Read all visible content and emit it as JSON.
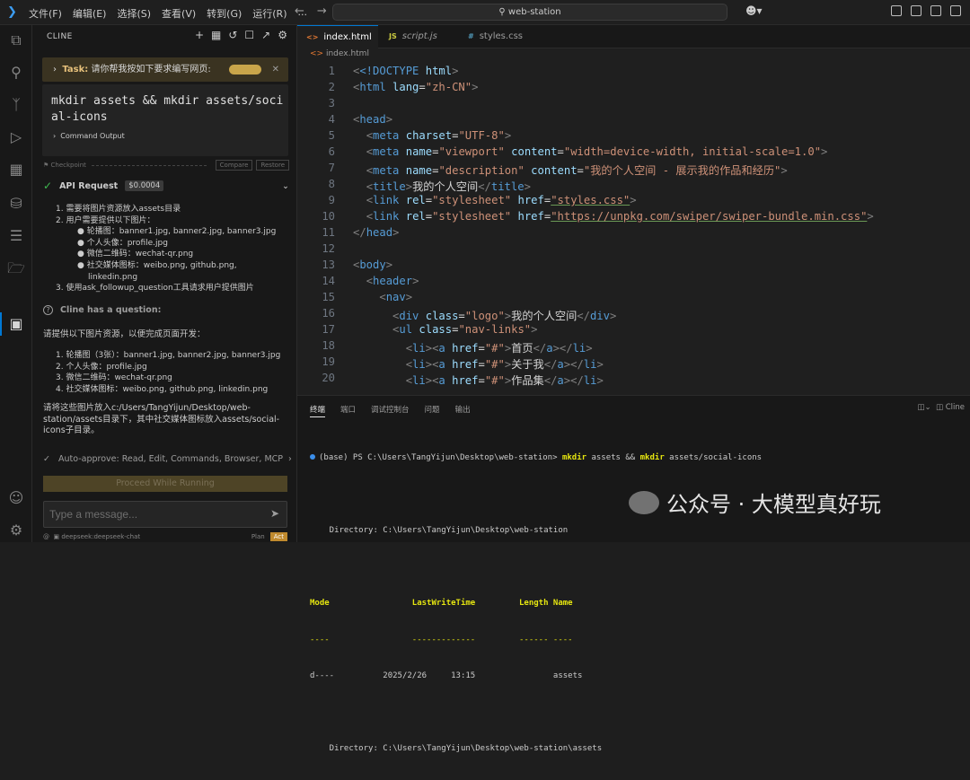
{
  "menu": [
    "文件(F)",
    "编辑(E)",
    "选择(S)",
    "查看(V)",
    "转到(G)",
    "运行(R)",
    "..."
  ],
  "search": {
    "text": "web-station"
  },
  "sidebar": {
    "title": "CLINE",
    "task_label": "Task:",
    "task_text": "请你帮我按如下要求编写网页:",
    "command": "mkdir assets && mkdir assets/social-icons",
    "command_output": "Command Output",
    "checkpoint": "Checkpoint",
    "compare": "Compare",
    "restore": "Restore",
    "api_label": "API Request",
    "api_cost": "$0.0004",
    "list1": [
      "1. 需要将图片资源放入assets目录",
      "2. 用户需要提供以下图片：",
      "轮播图：banner1.jpg, banner2.jpg, banner3.jpg",
      "个人头像：profile.jpg",
      "微信二维码：wechat-qr.png",
      "社交媒体图标：weibo.png, github.png,",
      "linkedin.png",
      "3. 使用ask_followup_question工具请求用户提供图片"
    ],
    "question_label": "Cline has a question:",
    "question_intro": "请提供以下图片资源，以便完成页面开发：",
    "list2": [
      "1. 轮播图（3张）：banner1.jpg, banner2.jpg, banner3.jpg",
      "2. 个人头像：profile.jpg",
      "3. 微信二维码：wechat-qr.png",
      "4. 社交媒体图标：weibo.png, github.png, linkedin.png"
    ],
    "closing": [
      "请将这些图片放入c:/Users/TangYijun/Desktop/web-",
      "station/assets目录下，其中社交媒体图标放入assets/social-",
      "icons子目录。"
    ],
    "auto_approve": "Auto-approve: Read, Edit, Commands, Browser, MCP",
    "proceed": "Proceed While Running",
    "message_placeholder": "Type a message...",
    "model": "deepseek:deepseek-chat",
    "plan": "Plan",
    "act": "Act"
  },
  "tabs": [
    "index.html",
    "script.js",
    "styles.css"
  ],
  "breadcrumb": "index.html",
  "line_numbers": [
    "1",
    "2",
    "3",
    "4",
    "5",
    "6",
    "7",
    "8",
    "9",
    "10",
    "11",
    "12",
    "13",
    "14",
    "15",
    "16",
    "17",
    "18",
    "19",
    "20"
  ],
  "code": {
    "l1a": "<!DOCTYPE",
    "l1b": " html",
    "l1c": ">",
    "l2a": "html",
    "l2b": "lang",
    "l2c": "\"zh-CN\"",
    "l4": "head",
    "l5a": "meta",
    "l5b": "charset",
    "l5c": "\"UTF-8\"",
    "l6a": "meta",
    "l6b": "name",
    "l6c": "\"viewport\"",
    "l6d": "content",
    "l6e": "\"width=device-width, initial-scale=1.0\"",
    "l7a": "meta",
    "l7b": "name",
    "l7c": "\"description\"",
    "l7d": "content",
    "l7e": "\"我的个人空间 - 展示我的作品和经历\"",
    "l8a": "title",
    "l8b": "我的个人空间",
    "l8c": "title",
    "l9a": "link",
    "l9b": "rel",
    "l9c": "\"stylesheet\"",
    "l9d": "href",
    "l9e": "\"styles.css\"",
    "l10a": "link",
    "l10b": "rel",
    "l10c": "\"stylesheet\"",
    "l10d": "href",
    "l10e": "\"https://unpkg.com/swiper/swiper-bundle.min.css\"",
    "l11": "head",
    "l13": "body",
    "l14": "header",
    "l15": "nav",
    "l16a": "div",
    "l16b": "class",
    "l16c": "\"logo\"",
    "l16d": "我的个人空间",
    "l16e": "div",
    "l17a": "ul",
    "l17b": "class",
    "l17c": "\"nav-links\"",
    "l18t": "首页",
    "l19t": "关于我",
    "l20t": "作品集",
    "li": "li",
    "a": "a",
    "href": "href",
    "hash": "\"#\""
  },
  "panel": {
    "tabs": [
      "终端",
      "端口",
      "调试控制台",
      "问题",
      "输出"
    ],
    "right": "Cline",
    "prompt": "(base) PS C:\\Users\\TangYijun\\Desktop\\web-station>",
    "cmd1": "mkdir",
    "cmd_mid": " assets && ",
    "cmd2": "mkdir",
    "cmd_end": " assets/social-icons",
    "dir1": "    Directory: C:\\Users\\TangYijun\\Desktop\\web-station",
    "header": "Mode                 LastWriteTime         Length Name",
    "dashes": "----                 -------------         ------ ----",
    "row": "d----          2025/2/26     13:15                assets",
    "dir2": "    Directory: C:\\Users\\TangYijun\\Desktop\\web-station\\assets"
  },
  "watermark": "公众号 · 大模型真好玩"
}
